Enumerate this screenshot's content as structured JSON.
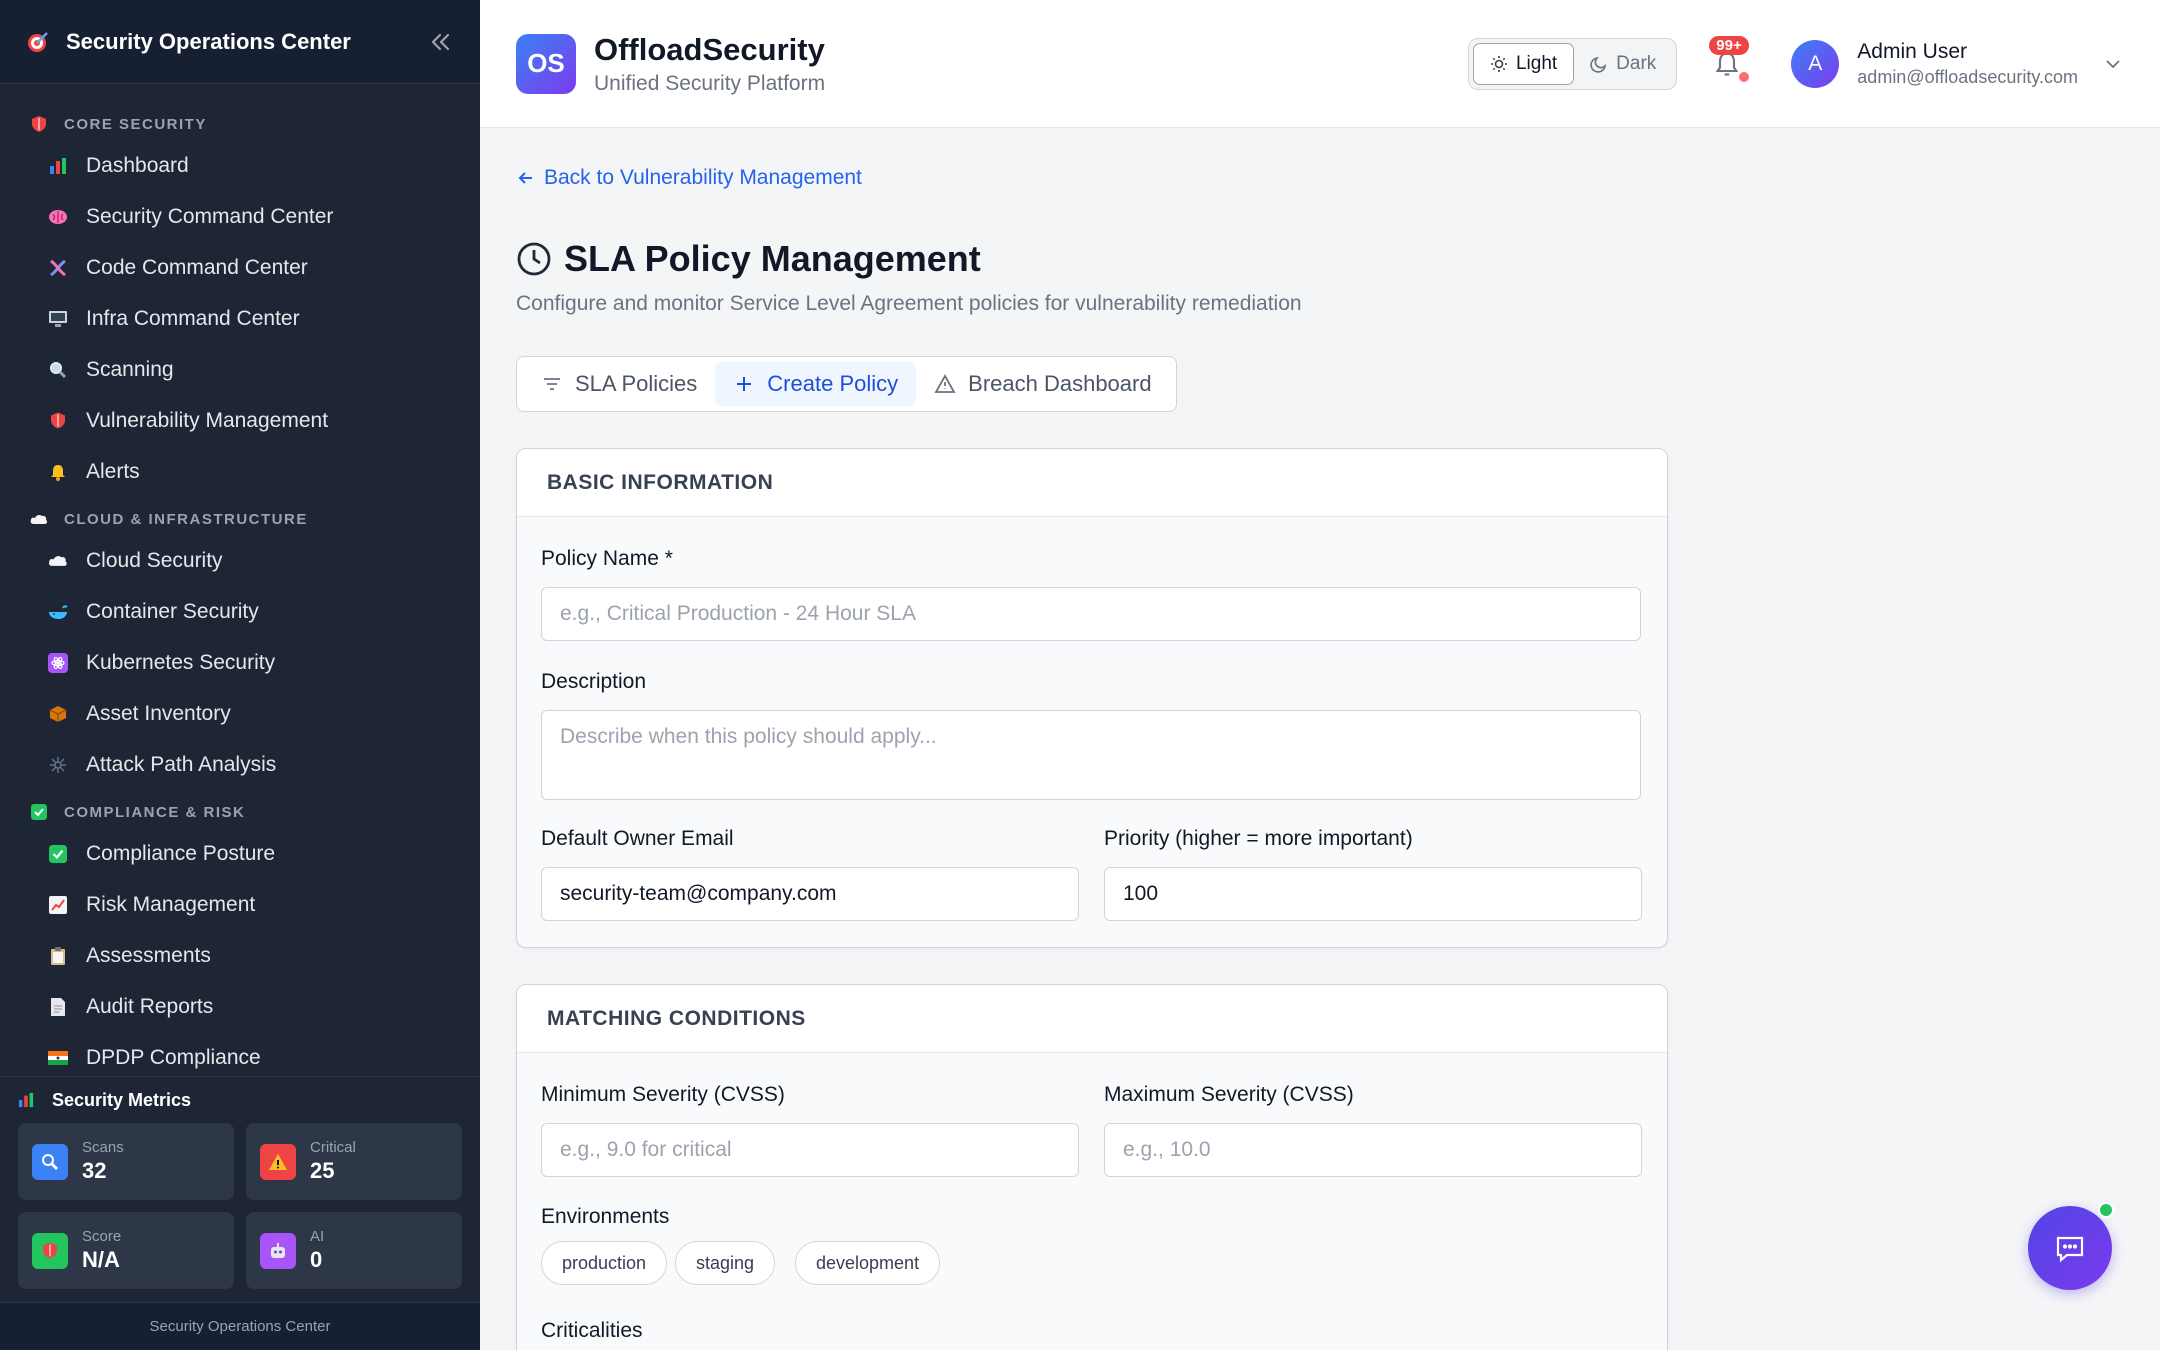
{
  "sidebar": {
    "title": "Security Operations Center",
    "sections": [
      {
        "label": "CORE SECURITY",
        "icon": "shield-icon",
        "items": [
          {
            "label": "Dashboard",
            "icon": "bar-chart-icon",
            "color": "#3b82f6"
          },
          {
            "label": "Security Command Center",
            "icon": "brain-icon",
            "color": "#ec4899"
          },
          {
            "label": "Code Command Center",
            "icon": "dna-icon",
            "color": "#6366f1"
          },
          {
            "label": "Infra Command Center",
            "icon": "monitor-icon",
            "color": "#64748b"
          },
          {
            "label": "Scanning",
            "icon": "magnifier-icon",
            "color": "#94a3b8"
          },
          {
            "label": "Vulnerability Management",
            "icon": "shield-icon",
            "color": "#ef4444"
          },
          {
            "label": "Alerts",
            "icon": "bell-icon",
            "color": "#f59e0b"
          }
        ]
      },
      {
        "label": "CLOUD & INFRASTRUCTURE",
        "icon": "cloud-icon",
        "items": [
          {
            "label": "Cloud Security",
            "icon": "cloud-icon",
            "color": "#e5e7eb"
          },
          {
            "label": "Container Security",
            "icon": "whale-icon",
            "color": "#0ea5e9"
          },
          {
            "label": "Kubernetes Security",
            "icon": "atom-icon",
            "color": "#a855f7"
          },
          {
            "label": "Asset Inventory",
            "icon": "package-icon",
            "color": "#b45309"
          },
          {
            "label": "Attack Path Analysis",
            "icon": "network-icon",
            "color": "#64748b"
          }
        ]
      },
      {
        "label": "COMPLIANCE & RISK",
        "icon": "check-box-icon",
        "items": [
          {
            "label": "Compliance Posture",
            "icon": "check-box-icon",
            "color": "#22c55e"
          },
          {
            "label": "Risk Management",
            "icon": "trend-chart-icon",
            "color": "#f1f5f9"
          },
          {
            "label": "Assessments",
            "icon": "clipboard-icon",
            "color": "#d6b98c"
          },
          {
            "label": "Audit Reports",
            "icon": "document-icon",
            "color": "#e5e7eb"
          },
          {
            "label": "DPDP Compliance",
            "icon": "india-flag-icon",
            "color": "#f97316"
          }
        ]
      }
    ],
    "metrics": {
      "title": "Security Metrics",
      "items": [
        {
          "label": "Scans",
          "value": "32",
          "icon": "magnifier-icon",
          "color": "#3b82f6"
        },
        {
          "label": "Critical",
          "value": "25",
          "icon": "warning-icon",
          "color": "#ef4444"
        },
        {
          "label": "Score",
          "value": "N/A",
          "icon": "shield-icon",
          "color": "#22c55e"
        },
        {
          "label": "AI",
          "value": "0",
          "icon": "robot-icon",
          "color": "#a855f7"
        }
      ]
    },
    "footer": "Security Operations Center"
  },
  "header": {
    "logo_text": "OS",
    "brand": "OffloadSecurity",
    "subtitle": "Unified Security Platform",
    "theme_light": "Light",
    "theme_dark": "Dark",
    "notif_count": "99+",
    "avatar_letter": "A",
    "user_name": "Admin User",
    "user_email": "admin@offloadsecurity.com"
  },
  "main": {
    "back_link": "Back to Vulnerability Management",
    "title": "SLA Policy Management",
    "description": "Configure and monitor Service Level Agreement policies for vulnerability remediation",
    "tabs": [
      {
        "label": "SLA Policies",
        "icon": "filter-icon",
        "active": false
      },
      {
        "label": "Create Policy",
        "icon": "plus-icon",
        "active": true
      },
      {
        "label": "Breach Dashboard",
        "icon": "warning-icon",
        "active": false
      }
    ],
    "basic": {
      "heading": "BASIC INFORMATION",
      "policy_name_label": "Policy Name *",
      "policy_name_placeholder": "e.g., Critical Production - 24 Hour SLA",
      "description_label": "Description",
      "description_placeholder": "Describe when this policy should apply...",
      "owner_label": "Default Owner Email",
      "owner_value": "security-team@company.com",
      "priority_label": "Priority (higher = more important)",
      "priority_value": "100"
    },
    "matching": {
      "heading": "MATCHING CONDITIONS",
      "min_label": "Minimum Severity (CVSS)",
      "min_placeholder": "e.g., 9.0 for critical",
      "max_label": "Maximum Severity (CVSS)",
      "max_placeholder": "e.g., 10.0",
      "env_label": "Environments",
      "environments": [
        "production",
        "staging",
        "development"
      ],
      "crit_label": "Criticalities"
    }
  }
}
